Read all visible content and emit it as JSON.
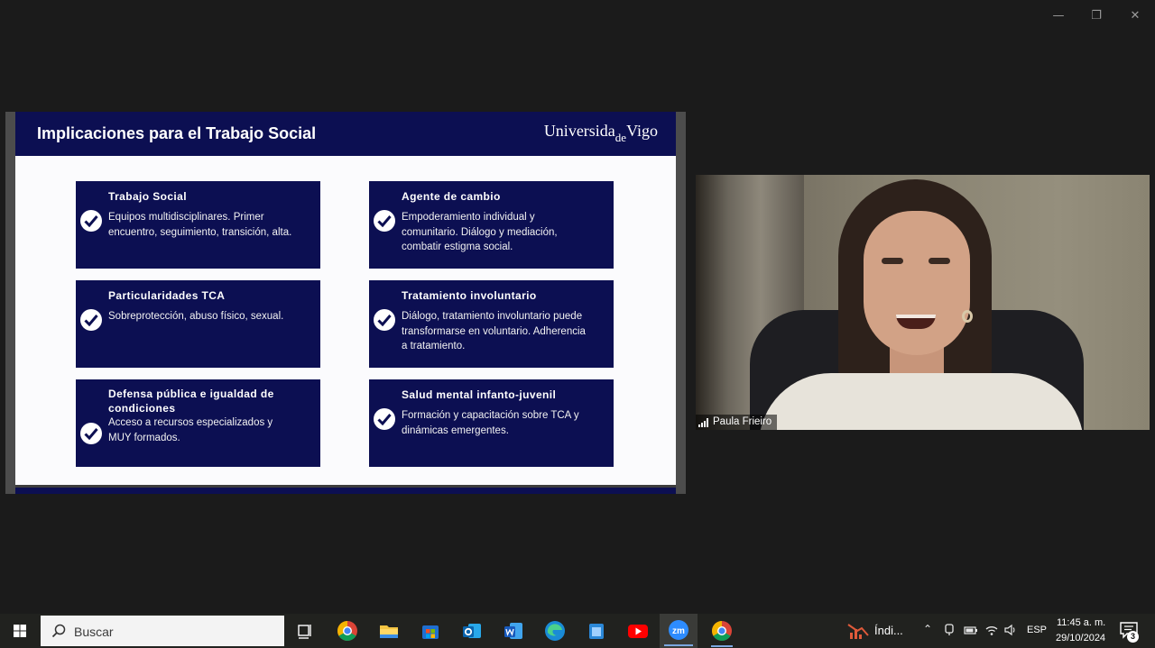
{
  "window": {
    "minimize_glyph": "—",
    "maximize_glyph": "❐",
    "close_glyph": "✕"
  },
  "slide": {
    "title": "Implicaciones para el Trabajo Social",
    "logo_text_1": "Universida",
    "logo_text_de": "de",
    "logo_text_2": "Vigo",
    "header_color": "#0c0f52",
    "cards": [
      {
        "title": "Trabajo Social",
        "body": "Equipos multidisciplinares. Primer encuentro, seguimiento, transición, alta."
      },
      {
        "title": "Agente de cambio",
        "body": "Empoderamiento individual y comunitario. Diálogo y mediación, combatir estigma social."
      },
      {
        "title": "Particularidades TCA",
        "body": "Sobreprotección, abuso físico, sexual."
      },
      {
        "title": "Tratamiento involuntario",
        "body": "Diálogo, tratamiento involuntario puede transformarse en voluntario. Adherencia a tratamiento."
      },
      {
        "title": "Defensa pública e igualdad de condiciones",
        "body": "Acceso a recursos especializados y MUY formados."
      },
      {
        "title": "Salud mental infanto-juvenil",
        "body": "Formación y capacitación sobre TCA y dinámicas emergentes."
      }
    ]
  },
  "video": {
    "participant_name": "Paula Frieiro"
  },
  "taskbar": {
    "search_placeholder": "Buscar",
    "zoom_label": "zm",
    "tray_app_label": "Índi...",
    "language": "ESP",
    "time": "11:45 a. m.",
    "date": "29/10/2024",
    "notification_count": "3"
  }
}
